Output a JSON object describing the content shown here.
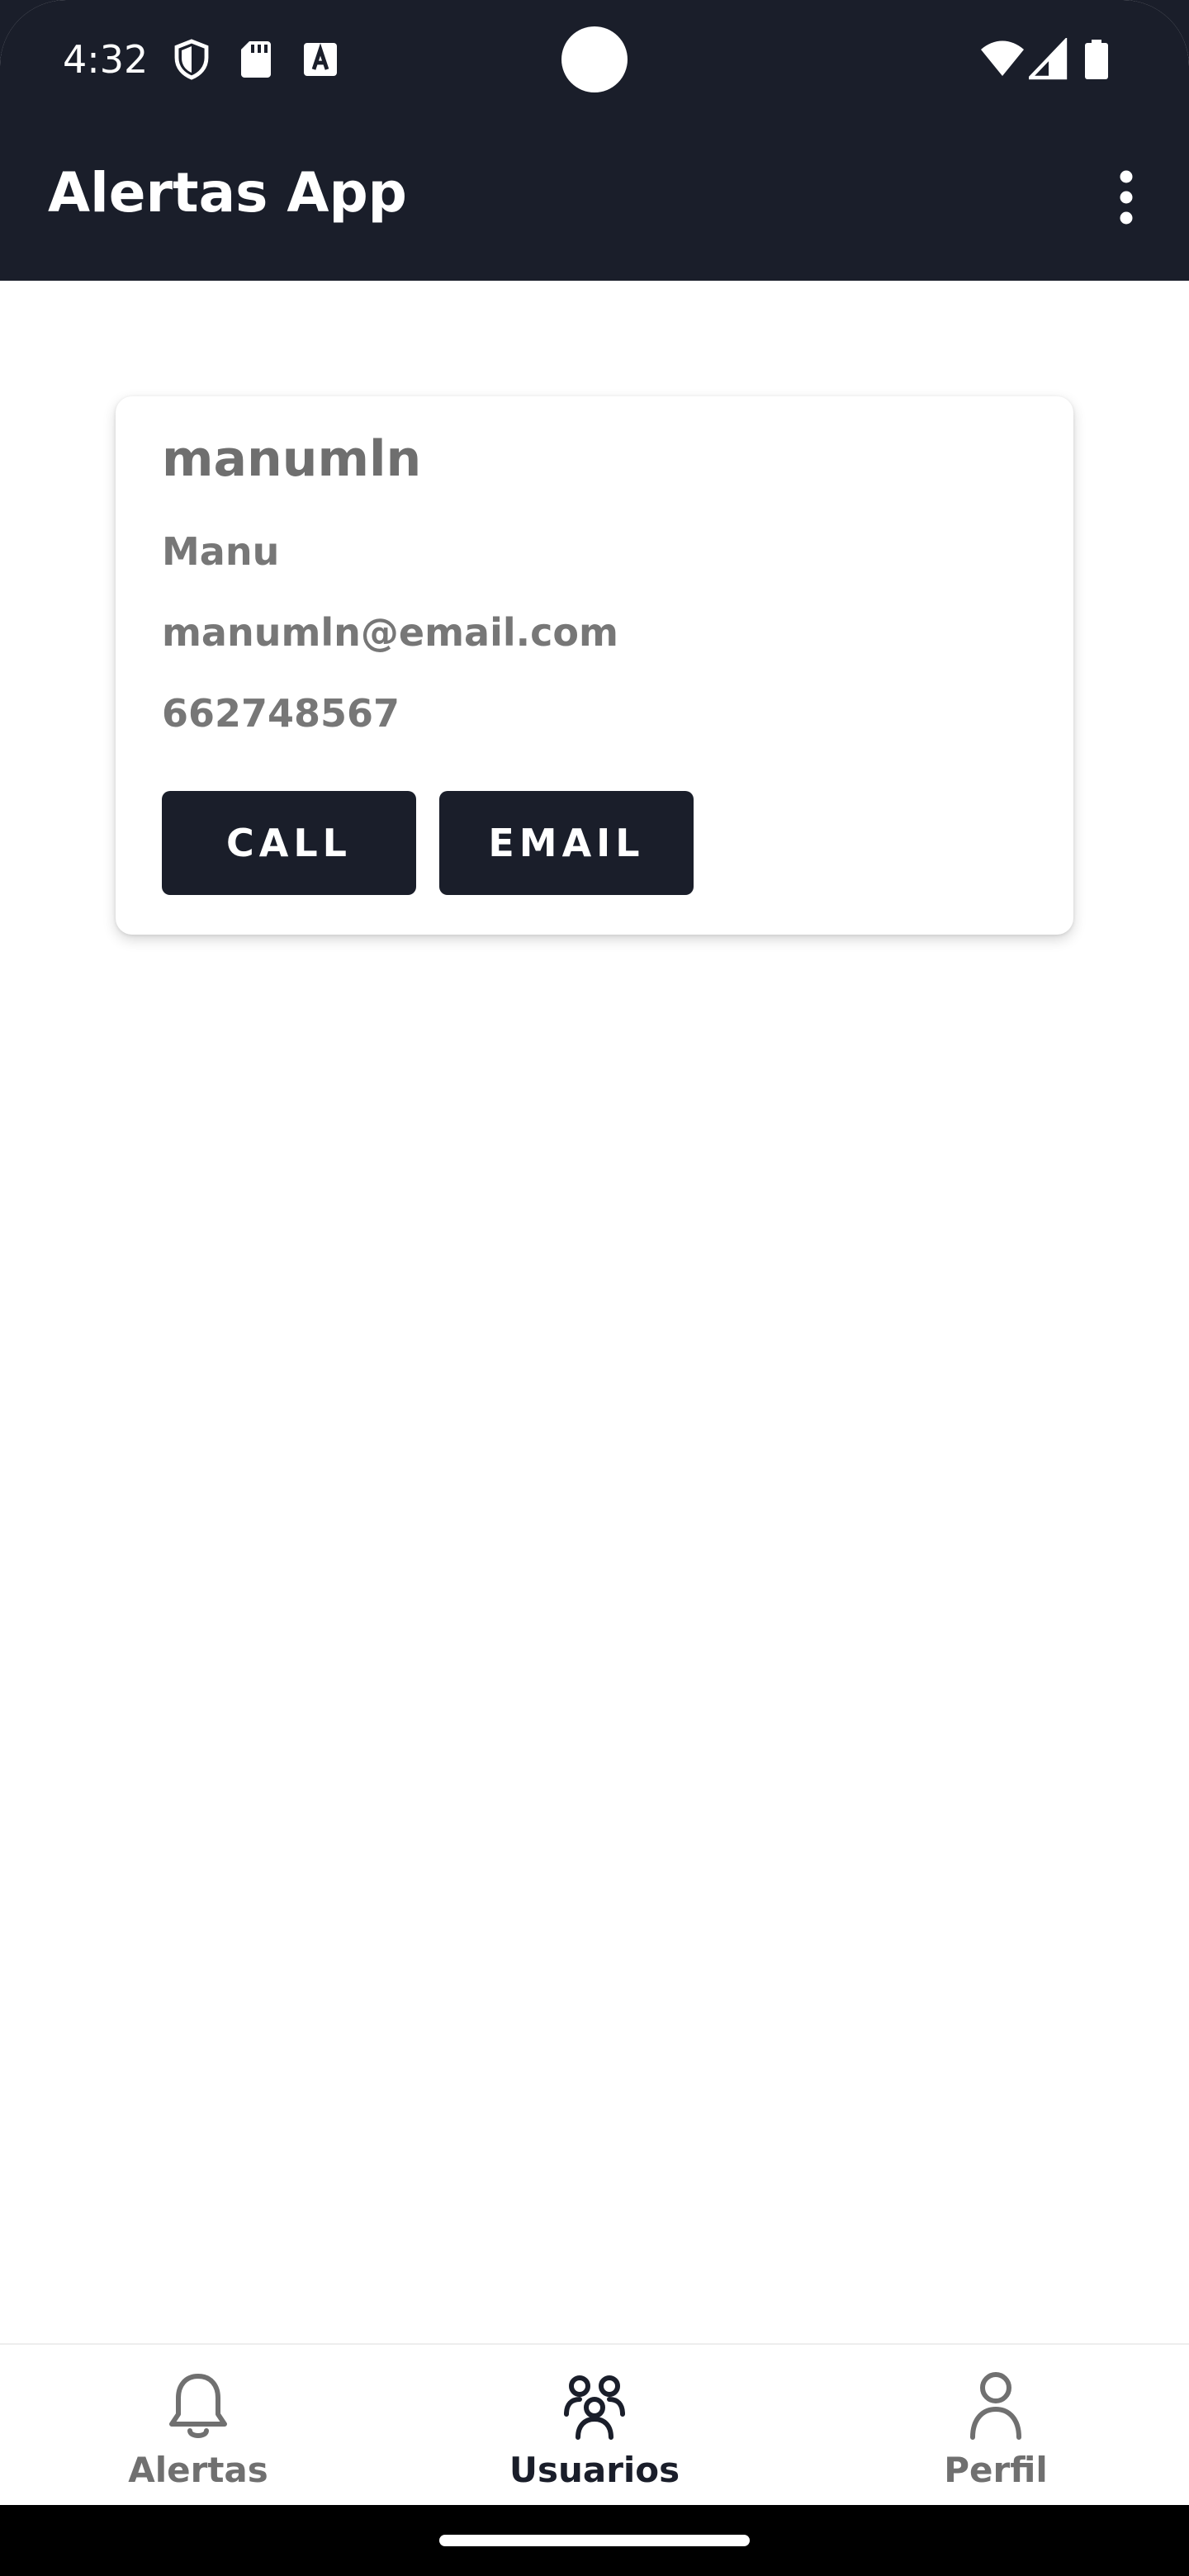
{
  "status_bar": {
    "time": "4:32",
    "icons": [
      "shield-icon",
      "sd-card-icon",
      "keyboard-a-icon",
      "wifi-icon",
      "signal-icon",
      "battery-icon"
    ]
  },
  "app_bar": {
    "title": "Alertas App",
    "menu_icon": "more-vert-icon"
  },
  "user_card": {
    "username": "manumln",
    "name": "Manu",
    "email": "manumln@email.com",
    "phone": "662748567",
    "call_label": "CALL",
    "email_label": "EMAIL"
  },
  "bottom_nav": {
    "items": [
      {
        "label": "Alertas",
        "icon": "bell-icon",
        "active": false
      },
      {
        "label": "Usuarios",
        "icon": "users-icon",
        "active": true
      },
      {
        "label": "Perfil",
        "icon": "person-icon",
        "active": false
      }
    ]
  },
  "colors": {
    "primary": "#1a1e2a",
    "text_muted": "#777777",
    "background": "#ffffff"
  }
}
